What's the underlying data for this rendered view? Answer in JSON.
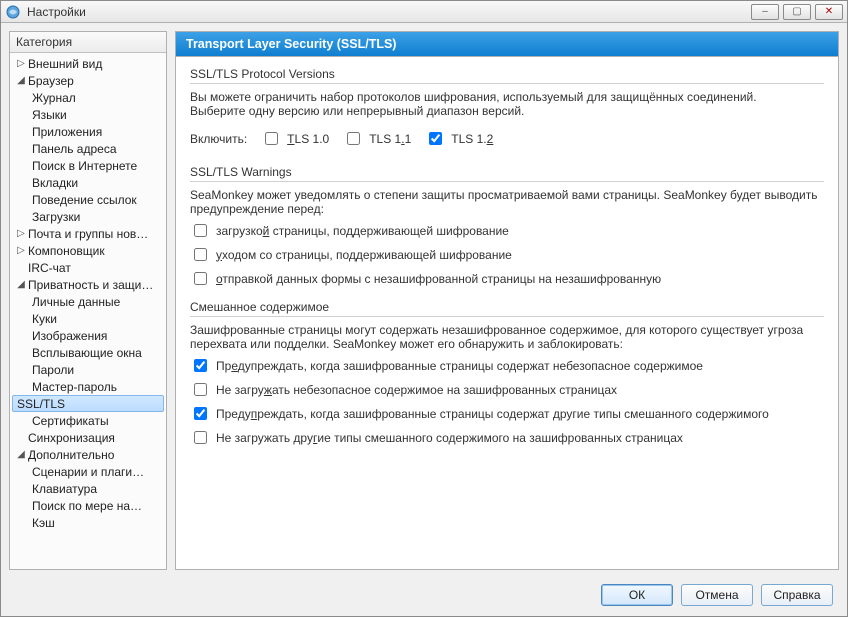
{
  "window": {
    "title": "Настройки",
    "buttons": {
      "min": "–",
      "max": "▢",
      "close": "✕"
    }
  },
  "sidebar": {
    "header": "Категория",
    "items": [
      {
        "label": "Внешний вид",
        "level": 0,
        "twisty": "▷"
      },
      {
        "label": "Браузер",
        "level": 0,
        "twisty": "◢"
      },
      {
        "label": "Журнал",
        "level": 1
      },
      {
        "label": "Языки",
        "level": 1
      },
      {
        "label": "Приложения",
        "level": 1
      },
      {
        "label": "Панель адреса",
        "level": 1
      },
      {
        "label": "Поиск в Интернете",
        "level": 1
      },
      {
        "label": "Вкладки",
        "level": 1
      },
      {
        "label": "Поведение ссылок",
        "level": 1
      },
      {
        "label": "Загрузки",
        "level": 1
      },
      {
        "label": "Почта и группы нов…",
        "level": 0,
        "twisty": "▷"
      },
      {
        "label": "Компоновщик",
        "level": 0,
        "twisty": "▷"
      },
      {
        "label": "IRC-чат",
        "level": 0
      },
      {
        "label": "Приватность и защи…",
        "level": 0,
        "twisty": "◢"
      },
      {
        "label": "Личные данные",
        "level": 1
      },
      {
        "label": "Куки",
        "level": 1
      },
      {
        "label": "Изображения",
        "level": 1
      },
      {
        "label": "Всплывающие окна",
        "level": 1
      },
      {
        "label": "Пароли",
        "level": 1
      },
      {
        "label": "Мастер-пароль",
        "level": 1
      },
      {
        "label": "SSL/TLS",
        "level": 1,
        "selected": true
      },
      {
        "label": "Сертификаты",
        "level": 1
      },
      {
        "label": "Синхронизация",
        "level": 0
      },
      {
        "label": "Дополнительно",
        "level": 0,
        "twisty": "◢"
      },
      {
        "label": "Сценарии и плаги…",
        "level": 1
      },
      {
        "label": "Клавиатура",
        "level": 1
      },
      {
        "label": "Поиск по мере на…",
        "level": 1
      },
      {
        "label": "Кэш",
        "level": 1
      }
    ]
  },
  "content": {
    "title": "Transport Layer Security (SSL/TLS)",
    "protocols": {
      "group_title": "SSL/TLS Protocol Versions",
      "desc1": "Вы можете ограничить набор протоколов шифрования, используемый для защищённых соединений.",
      "desc2": "Выберите одну версию или непрерывный диапазон версий.",
      "enable_label": "Включить:",
      "tls10": {
        "pre": "",
        "u": "T",
        "post": "LS 1.0",
        "checked": false
      },
      "tls11": {
        "pre": "TLS 1",
        "u": ".",
        "post": "1",
        "checked": false
      },
      "tls12": {
        "pre": "TLS 1.",
        "u": "2",
        "post": "",
        "checked": true
      }
    },
    "warnings": {
      "group_title": "SSL/TLS Warnings",
      "desc": "SeaMonkey может уведомлять о степени защиты просматриваемой вами страницы. SeaMonkey будет выводить предупреждение перед:",
      "items": [
        {
          "checked": false,
          "pre": "загрузко",
          "u": "й",
          "post": " страницы, поддерживающей шифрование"
        },
        {
          "checked": false,
          "pre": "",
          "u": "у",
          "post": "ходом со страницы, поддерживающей шифрование"
        },
        {
          "checked": false,
          "pre": "",
          "u": "о",
          "post": "тправкой данных формы с незашифрованной страницы на незашифрованную"
        }
      ]
    },
    "mixed": {
      "group_title": "Смешанное содержимое",
      "desc": "Зашифрованные страницы могут содержать незашифрованное содержимое, для которого существует угроза перехвата или подделки. SeaMonkey может его обнаружить и заблокировать:",
      "items": [
        {
          "checked": true,
          "pre": "Пр",
          "u": "е",
          "post": "дупреждать, когда зашифрованные страницы содержат небезопасное содержимое"
        },
        {
          "checked": false,
          "pre": "Не загру",
          "u": "ж",
          "post": "ать небезопасное содержимое на зашифрованных страницах"
        },
        {
          "checked": true,
          "pre": "Преду",
          "u": "п",
          "post": "реждать, когда зашифрованные страницы содержат другие типы смешанного содержимого"
        },
        {
          "checked": false,
          "pre": "Не загружать дру",
          "u": "г",
          "post": "ие типы смешанного содержимого на зашифрованных страницах"
        }
      ]
    }
  },
  "buttons": {
    "ok": "ОК",
    "cancel": "Отмена",
    "help": "Справка"
  }
}
